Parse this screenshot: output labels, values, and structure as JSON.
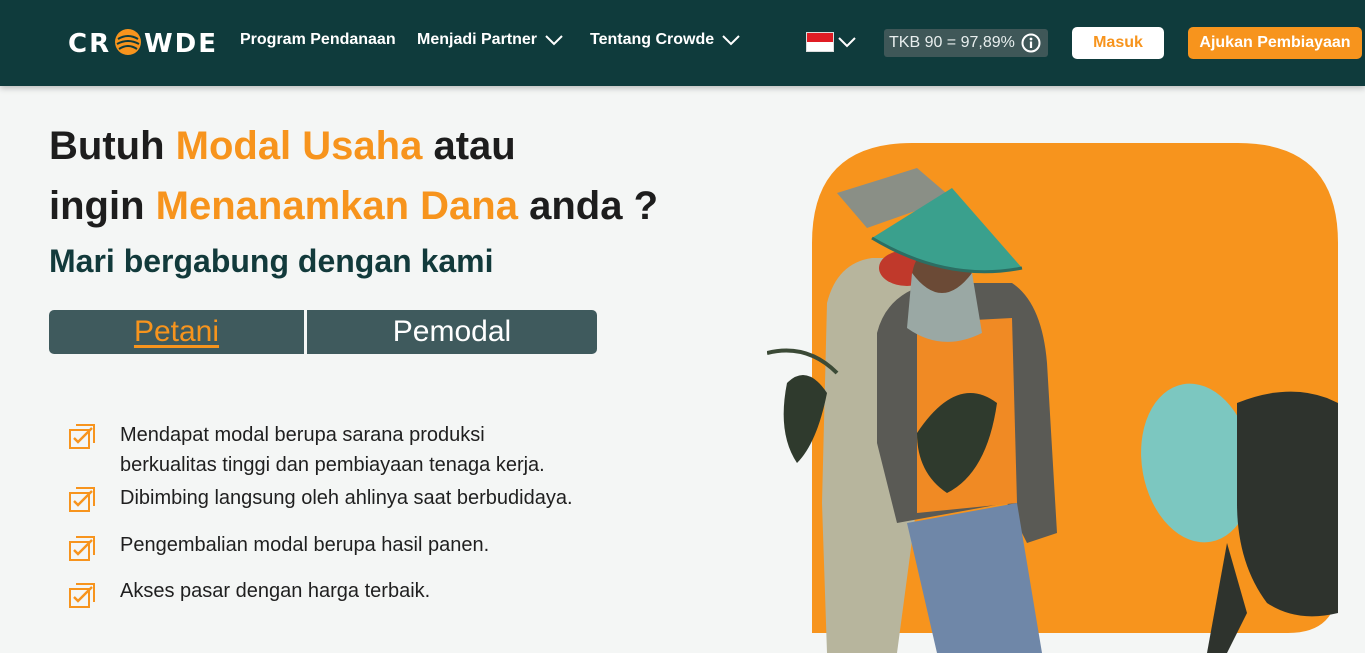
{
  "nav": {
    "logo": "CROWDE",
    "menu": [
      {
        "label": "Program Pendanaan"
      },
      {
        "label": "Menjadi Partner"
      },
      {
        "label": "Tentang Crowde"
      }
    ],
    "tkb": "TKB 90 = 97,89%",
    "login": "Masuk",
    "apply": "Ajukan Pembiayaan"
  },
  "hero": {
    "line1_a": "Butuh ",
    "line1_b": "Modal Usaha",
    "line1_c": " atau",
    "line2_a": "ingin ",
    "line2_b": "Menanamkan Dana",
    "line2_c": " anda ?",
    "subtitle": "Mari bergabung dengan kami"
  },
  "tabs": {
    "petani": "Petani",
    "pemodal": "Pemodal"
  },
  "benefits": [
    {
      "line1": "Mendapat modal berupa sarana produksi",
      "line2": "berkualitas tinggi dan pembiayaan tenaga kerja."
    },
    {
      "line1": "Dibimbing langsung oleh ahlinya saat berbudidaya."
    },
    {
      "line1": "Pengembalian modal berupa hasil panen."
    },
    {
      "line1": "Akses pasar dengan harga terbaik."
    }
  ],
  "colors": {
    "nav_bg": "#0f3b3c",
    "accent": "#f7941d",
    "page_bg": "#f4f6f5",
    "tab_bg": "#3f5a5d"
  },
  "icons": [
    "chevron-down-icon",
    "info-icon",
    "checkbox-checked-icon",
    "indonesia-flag-icon"
  ]
}
